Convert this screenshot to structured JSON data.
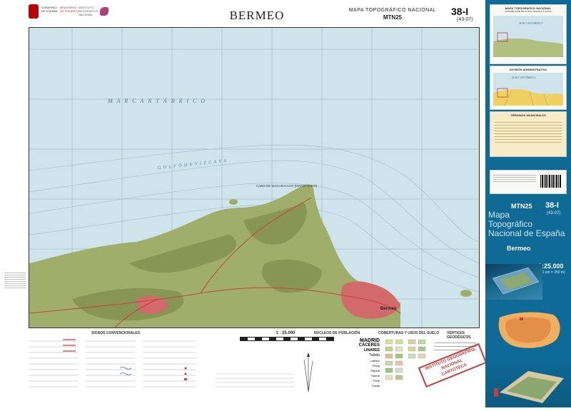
{
  "header": {
    "agency_lines": [
      "GOBIERNO",
      "DE ESPAÑA",
      "MINISTERIO",
      "DE FOMENTO"
    ],
    "ign_lines": [
      "INSTITUTO",
      "GEOGRÁFICO",
      "NACIONAL"
    ],
    "title": "BERMEO",
    "series_line1": "MAPA TOPOGRÁFICO NACIONAL",
    "series_line2": "MTN25",
    "sheet_number": "38-I",
    "sheet_sub": "(43-07)"
  },
  "map": {
    "sea_label": "M A R   C A N T Á B R I C O",
    "gulf_label": "G O L F O   D E   V I Z C A Y A",
    "cape_label": "CABO DE MACHICHACO (MATXITXAKO)",
    "town_label": "Bermeo",
    "colors": {
      "sea": "#cfe3ea",
      "land": "#9fae6a",
      "relief": "#7f8d4e",
      "urban": "#d26a6a",
      "roads": "#c84040"
    }
  },
  "legend": {
    "conventional_signs_title": "SIGNOS CONVENCIONALES",
    "scale": "1 : 25.000",
    "population_title": "NÚCLEOS DE POBLACIÓN",
    "population_samples": [
      "MADRID",
      "CÁCERES",
      "LINARES",
      "Tudela",
      "Lantarn",
      "Pinsp",
      "Rapela",
      "Huerte",
      "Porte",
      "Casas"
    ],
    "coverage_title": "COBERTURAS Y USOS DEL SUELO",
    "geodetic_title": "VÉRTICES GEODÉSICOS",
    "stamp_lines": [
      "INSTITUTO GEOGRÁFICO",
      "NACIONAL",
      "CARTOTECA"
    ]
  },
  "cover": {
    "top_title": "MAPA TOPOGRÁFICO NACIONAL",
    "top_sub": "DISTRIBUCIÓN DE HOJAS A ESCALA 1:50.000",
    "admin_title": "DIVISIÓN ADMINISTRATIVA",
    "municipal_title": "TÉRMINOS MUNICIPALES",
    "mini_sea": "MAR CANTÁBRICO",
    "code": "MTN25",
    "sheet": "38-I",
    "sheet_sub": "(43-07)",
    "title_lines": [
      "Mapa",
      "Topográfico",
      "Nacional de España"
    ],
    "place": "Bermeo",
    "scale": "1:25.000",
    "scale_sub": "(1 cm = 250 m)"
  }
}
